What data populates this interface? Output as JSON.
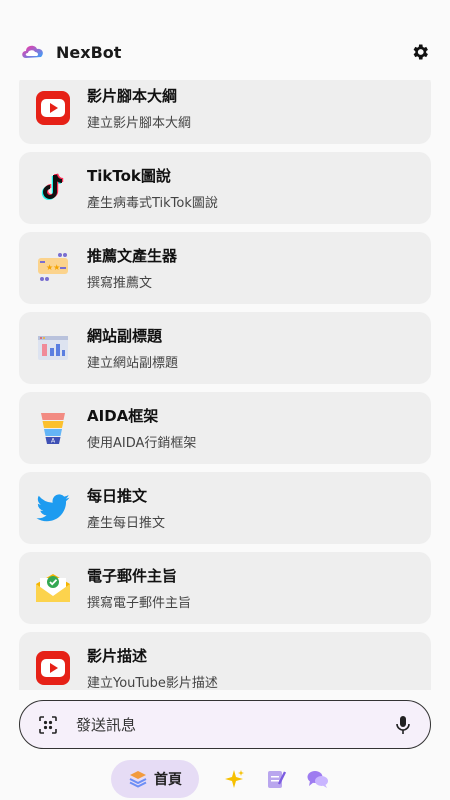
{
  "app": {
    "title": "NexBot"
  },
  "cards": [
    {
      "title": "影片腳本大綱",
      "subtitle": "建立影片腳本大綱",
      "icon": "youtube-icon"
    },
    {
      "title": "TikTok圖說",
      "subtitle": "產生病毒式TikTok圖說",
      "icon": "tiktok-icon"
    },
    {
      "title": "推薦文產生器",
      "subtitle": "撰寫推薦文",
      "icon": "testimonial-icon"
    },
    {
      "title": "網站副標題",
      "subtitle": "建立網站副標題",
      "icon": "website-icon"
    },
    {
      "title": "AIDA框架",
      "subtitle": "使用AIDA行銷框架",
      "icon": "funnel-icon"
    },
    {
      "title": "每日推文",
      "subtitle": "產生每日推文",
      "icon": "twitter-icon"
    },
    {
      "title": "電子郵件主旨",
      "subtitle": "撰寫電子郵件主旨",
      "icon": "email-icon"
    },
    {
      "title": "影片描述",
      "subtitle": "建立YouTube影片描述",
      "icon": "youtube-icon"
    }
  ],
  "input": {
    "placeholder": "發送訊息"
  },
  "nav": {
    "home_label": "首頁"
  },
  "colors": {
    "accent": "#e6dcf5",
    "youtube": "#e62117",
    "twitter": "#1d9bf0"
  }
}
